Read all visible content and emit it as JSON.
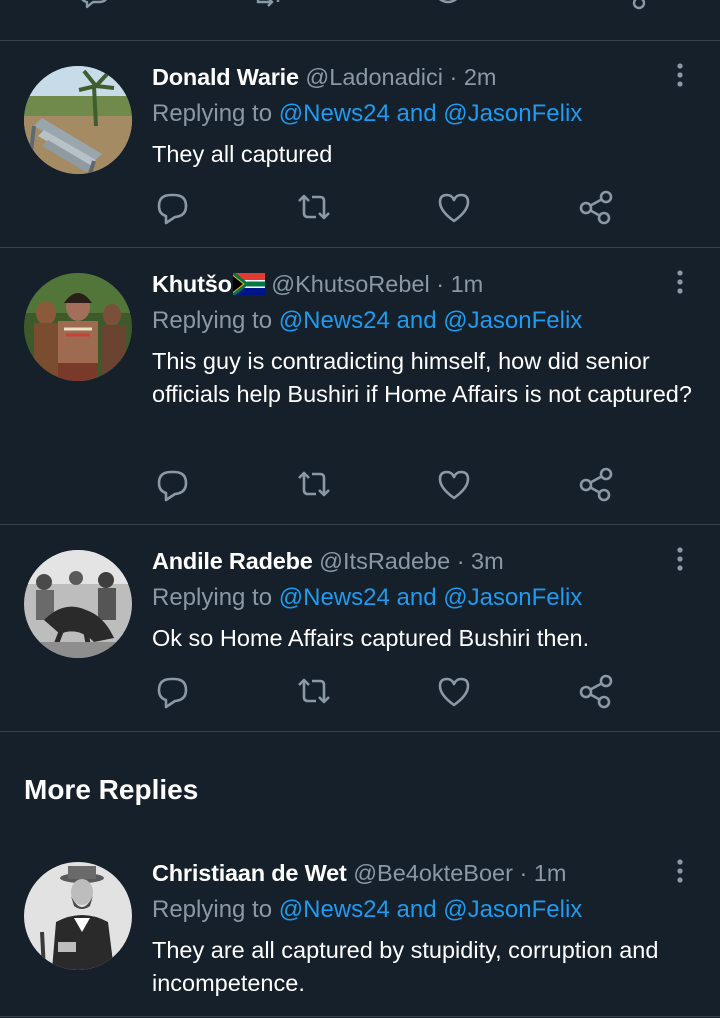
{
  "theme": {
    "background": "#15202b",
    "divider": "#38444d",
    "secondary_text": "#8b98a5",
    "link": "#1d9bf0",
    "icon": "#8b98a5"
  },
  "replying_prefix": "Replying to",
  "mentions": [
    "@News24",
    "@JasonFelix"
  ],
  "mention_joiner": "and",
  "tweets": [
    {
      "name": "Donald Warie",
      "handle": "@Ladonadici",
      "separator": "·",
      "time": "2m",
      "text": "They all captured",
      "avatar": "bench-photo"
    },
    {
      "name": "Khutšo",
      "flag": "south-africa-flag",
      "handle": "@KhutsoRebel",
      "separator": "·",
      "time": "1m",
      "text": "This guy is contradicting himself, how did senior officials help Bushiri if Home Affairs is not captured?",
      "avatar": "warriors-photo"
    },
    {
      "name": "Andile Radebe",
      "handle": "@ItsRadebe",
      "separator": "·",
      "time": "3m",
      "text": "Ok so Home Affairs captured Bushiri then.",
      "avatar": "bw-crowd-photo"
    },
    {
      "name": "Christiaan de Wet",
      "handle": "@Be4okteBoer",
      "separator": "·",
      "time": "1m",
      "text": "They are all captured by stupidity, corruption and incompetence.",
      "avatar": "bw-portrait-photo"
    }
  ],
  "more_replies_title": "More Replies",
  "action_icons": [
    "reply-icon",
    "retweet-icon",
    "like-icon",
    "share-icon"
  ]
}
